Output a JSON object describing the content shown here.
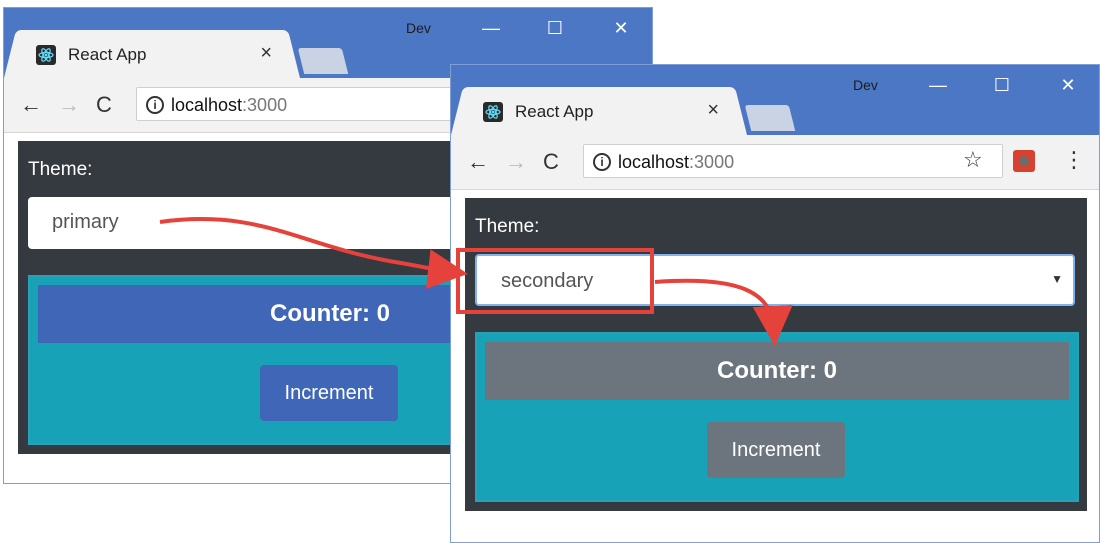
{
  "windows": [
    {
      "id": "back",
      "tab_title": "React App",
      "tab_close": "×",
      "profile": "Dev",
      "url_host": "localhost",
      "url_port": ":3000",
      "theme_label": "Theme:",
      "selected_theme": "primary",
      "counter_text": "Counter: 0",
      "button_label": "Increment"
    },
    {
      "id": "front",
      "tab_title": "React App",
      "tab_close": "×",
      "profile": "Dev",
      "url_host": "localhost",
      "url_port": ":3000",
      "theme_label": "Theme:",
      "selected_theme": "secondary",
      "counter_text": "Counter: 0",
      "button_label": "Increment"
    }
  ],
  "icons": {
    "back": "←",
    "forward": "→",
    "reload": "C",
    "info": "i",
    "star": "☆",
    "kebab": "⋮",
    "caret": "▼",
    "minimize": "—",
    "maximize": "☐",
    "close": "✕"
  },
  "colors": {
    "titlebar": "#4b77c4",
    "page_bg": "#343a40",
    "primary": "#3f66b7",
    "secondary": "#6c757d",
    "info": "#17a2b8",
    "annotation": "#e5423b"
  }
}
